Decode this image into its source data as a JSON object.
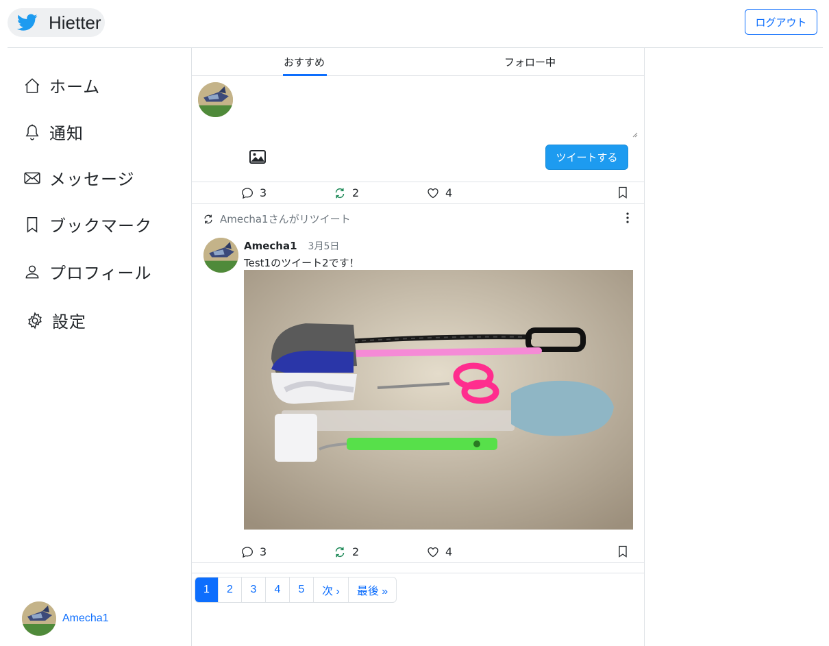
{
  "header": {
    "brand_name": "Hietter",
    "logout_label": "ログアウト"
  },
  "sidebar": {
    "items": [
      {
        "label": "ホーム",
        "icon": "house-icon"
      },
      {
        "label": "通知",
        "icon": "bell-icon"
      },
      {
        "label": "メッセージ",
        "icon": "envelope-icon"
      },
      {
        "label": "ブックマーク",
        "icon": "bookmark-icon"
      },
      {
        "label": "プロフィール",
        "icon": "person-icon"
      },
      {
        "label": "設定",
        "icon": "gear-icon"
      }
    ],
    "user_name": "Amecha1"
  },
  "tabs": [
    {
      "label": "おすすめ",
      "active": true
    },
    {
      "label": "フォロー中",
      "active": false
    }
  ],
  "compose": {
    "placeholder": "",
    "submit_label": "ツイートする"
  },
  "first_tweet_actions": {
    "replies": "3",
    "retweets": "2",
    "likes": "4"
  },
  "retweeted_tweet": {
    "retweet_notice": "Amecha1さんがリツイート",
    "author": "Amecha1",
    "date": "3月5日",
    "text": "Test1のツイート2です！",
    "actions": {
      "replies": "3",
      "retweets": "2",
      "likes": "4"
    }
  },
  "pagination": {
    "pages": [
      "1",
      "2",
      "3",
      "4",
      "5"
    ],
    "next_label": "次 ›",
    "last_label": "最後 »",
    "current": "1"
  },
  "colors": {
    "primary": "#0d6efd",
    "tweet_button": "#1d9bf0",
    "retweet_green": "#198754",
    "twitter_blue": "#1d9bf0"
  }
}
